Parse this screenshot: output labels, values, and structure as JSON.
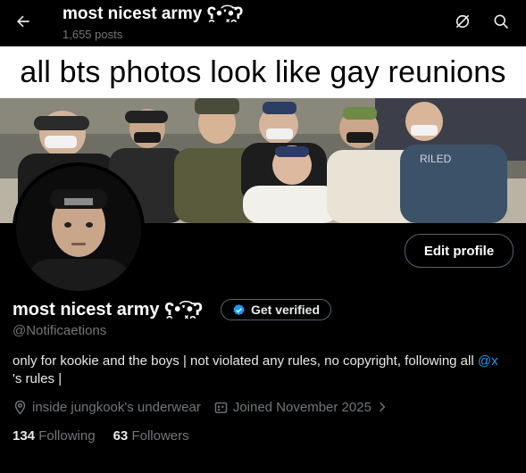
{
  "header": {
    "title": "most nicest army ʕ̯•͡ˑ͓•̯᷅ʔ",
    "post_count": "1,655 posts",
    "back_icon": "arrow-left-icon",
    "hide_icon": "slash-circle-icon",
    "search_icon": "search-icon"
  },
  "banner": {
    "caption": "all bts photos look like gay reunions"
  },
  "profile": {
    "edit_button": "Edit profile",
    "name": "most nicest army ʕ̯•͡ˑ͓•̯᷅ʔ",
    "verify_button": "Get verified",
    "handle": "@Notificaetions",
    "bio_text": "only for kookie and the boys | not violated any rules, no copyright, following all ",
    "bio_mention": "@x",
    "bio_tail": "'s rules |",
    "location": "inside jungkook's underwear",
    "joined": "Joined November 2025",
    "following_count": "134",
    "following_label": "Following",
    "followers_count": "63",
    "followers_label": "Followers"
  },
  "colors": {
    "background": "#000000",
    "text": "#e7e9ea",
    "secondary": "#71767b",
    "link": "#1d9bf0",
    "border": "#536471"
  }
}
